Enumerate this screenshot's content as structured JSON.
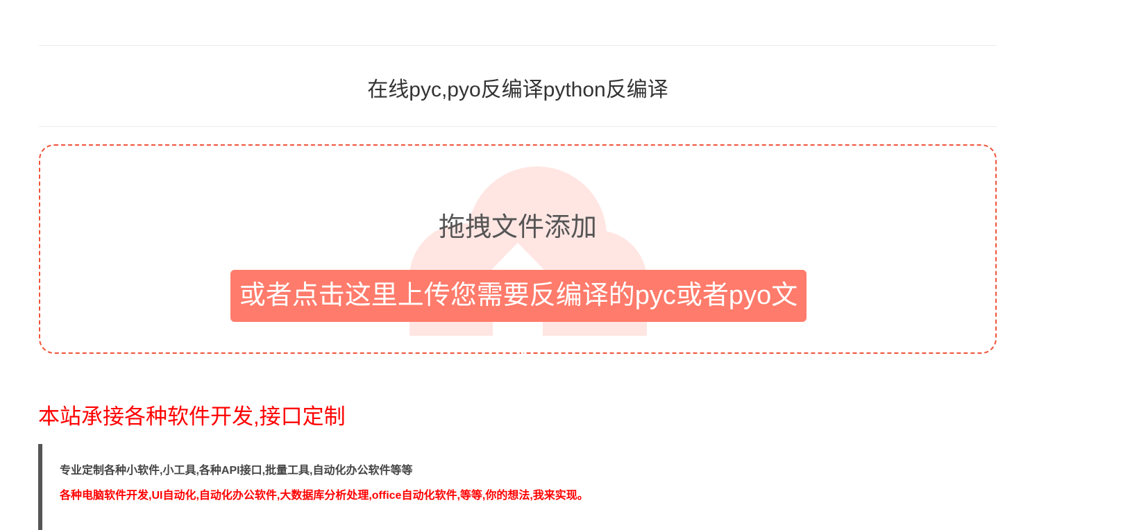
{
  "header": {
    "title": "在线pyc,pyo反编译python反编译"
  },
  "dropzone": {
    "drag_text": "拖拽文件添加",
    "upload_button_label": "或者点击这里上传您需要反编译的pyc或者pyo文件",
    "accent_color": "#f0533a",
    "button_color": "#ff7b6b",
    "icon": "cloud-upload-icon"
  },
  "promo": {
    "heading": "本站承接各种软件开发,接口定制",
    "line1": "专业定制各种小软件,小工具,各种API接口,批量工具,自动化办公软件等等",
    "line2": "各种电脑软件开发,UI自动化,自动化办公软件,大数据库分析处理,office自动化软件,等等,你的想法,我来实现。",
    "heading_color": "#ff0000"
  }
}
